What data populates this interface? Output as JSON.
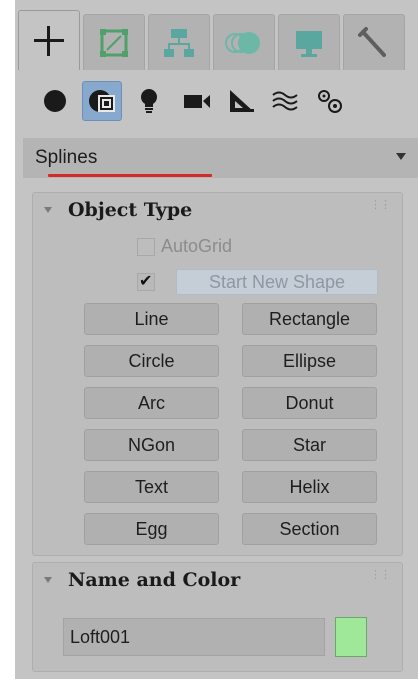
{
  "tabs": [
    {
      "name": "create",
      "icon": "plus-icon",
      "active": true
    },
    {
      "name": "modify",
      "icon": "modify-icon",
      "active": false
    },
    {
      "name": "hierarchy",
      "icon": "hierarchy-icon",
      "active": false
    },
    {
      "name": "motion",
      "icon": "motion-icon",
      "active": false
    },
    {
      "name": "display",
      "icon": "display-icon",
      "active": false
    },
    {
      "name": "utilities",
      "icon": "wrench-icon",
      "active": false
    }
  ],
  "categories": [
    {
      "icon": "geometry-sphere-icon",
      "active": false
    },
    {
      "icon": "shapes-icon",
      "active": true
    },
    {
      "icon": "lights-icon",
      "active": false
    },
    {
      "icon": "cameras-icon",
      "active": false
    },
    {
      "icon": "helpers-icon",
      "active": false
    },
    {
      "icon": "space-warps-icon",
      "active": false
    },
    {
      "icon": "systems-icon",
      "active": false
    }
  ],
  "dropdown": {
    "value": "Splines"
  },
  "object_type": {
    "title": "Object Type",
    "autogrid_label": "AutoGrid",
    "autogrid_checked": false,
    "start_new_shape_checked": true,
    "start_new_shape_label": "Start New Shape",
    "buttons": [
      "Line",
      "Rectangle",
      "Circle",
      "Ellipse",
      "Arc",
      "Donut",
      "NGon",
      "Star",
      "Text",
      "Helix",
      "Egg",
      "Section"
    ]
  },
  "name_and_color": {
    "title": "Name and Color",
    "name_value": "Loft001",
    "color": "#9fe89a"
  },
  "colors": {
    "accent_active": "#86a9cd",
    "underline": "#d42a2a"
  }
}
